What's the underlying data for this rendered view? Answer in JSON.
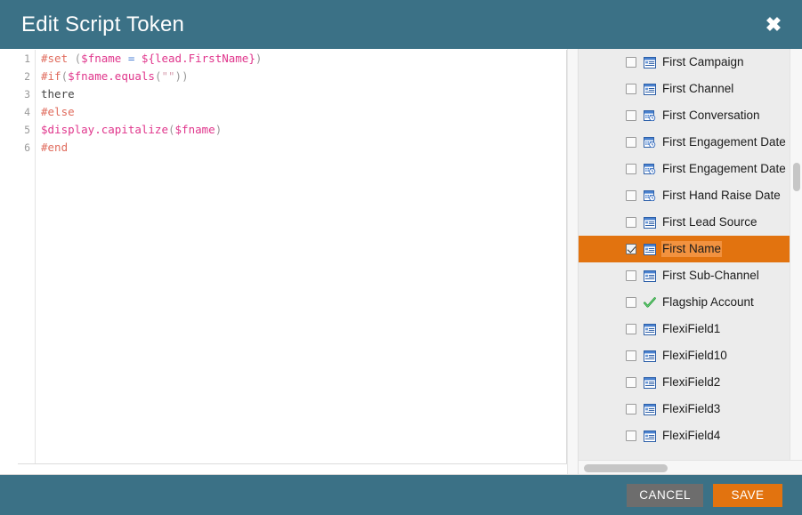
{
  "dialog": {
    "title": "Edit Script Token",
    "close_icon": "close-x-icon"
  },
  "editor": {
    "line_numbers": [
      "1",
      "2",
      "3",
      "4",
      "5",
      "6"
    ],
    "lines": [
      {
        "n": "1",
        "tokens": [
          {
            "t": "#set",
            "c": "directive"
          },
          {
            "t": " (",
            "c": "punct"
          },
          {
            "t": "$fname",
            "c": "var"
          },
          {
            "t": " ",
            "c": "plain"
          },
          {
            "t": "=",
            "c": "op"
          },
          {
            "t": " ",
            "c": "plain"
          },
          {
            "t": "${lead.FirstName}",
            "c": "var"
          },
          {
            "t": ")",
            "c": "punct"
          }
        ]
      },
      {
        "n": "2",
        "tokens": [
          {
            "t": "#if",
            "c": "directive"
          },
          {
            "t": "(",
            "c": "punct"
          },
          {
            "t": "$fname.equals",
            "c": "var"
          },
          {
            "t": "(",
            "c": "punct"
          },
          {
            "t": "\"\"",
            "c": "str"
          },
          {
            "t": "))",
            "c": "punct"
          }
        ]
      },
      {
        "n": "3",
        "tokens": [
          {
            "t": "there",
            "c": "plain"
          }
        ]
      },
      {
        "n": "4",
        "tokens": [
          {
            "t": "#else",
            "c": "directive"
          }
        ]
      },
      {
        "n": "5",
        "tokens": [
          {
            "t": "$display.capitalize",
            "c": "var"
          },
          {
            "t": "(",
            "c": "punct"
          },
          {
            "t": "$fname",
            "c": "var"
          },
          {
            "t": ")",
            "c": "punct"
          }
        ]
      },
      {
        "n": "6",
        "tokens": [
          {
            "t": "#end",
            "c": "directive"
          }
        ]
      }
    ]
  },
  "field_list": {
    "items": [
      {
        "label": "First Campaign",
        "icon": "text-field-icon",
        "checked": false,
        "selected": false
      },
      {
        "label": "First Channel",
        "icon": "text-field-icon",
        "checked": false,
        "selected": false
      },
      {
        "label": "First Conversation",
        "icon": "date-field-icon",
        "checked": false,
        "selected": false
      },
      {
        "label": "First Engagement Date",
        "icon": "date-field-icon",
        "checked": false,
        "selected": false
      },
      {
        "label": "First Engagement Date (",
        "icon": "date-field-icon",
        "checked": false,
        "selected": false
      },
      {
        "label": "First Hand Raise Date",
        "icon": "date-field-icon",
        "checked": false,
        "selected": false
      },
      {
        "label": "First Lead Source",
        "icon": "text-field-icon",
        "checked": false,
        "selected": false
      },
      {
        "label": "First Name",
        "icon": "text-field-icon",
        "checked": true,
        "selected": true
      },
      {
        "label": "First Sub-Channel",
        "icon": "text-field-icon",
        "checked": false,
        "selected": false
      },
      {
        "label": "Flagship Account",
        "icon": "boolean-field-icon",
        "checked": false,
        "selected": false
      },
      {
        "label": "FlexiField1",
        "icon": "text-field-icon",
        "checked": false,
        "selected": false
      },
      {
        "label": "FlexiField10",
        "icon": "text-field-icon",
        "checked": false,
        "selected": false
      },
      {
        "label": "FlexiField2",
        "icon": "text-field-icon",
        "checked": false,
        "selected": false
      },
      {
        "label": "FlexiField3",
        "icon": "text-field-icon",
        "checked": false,
        "selected": false
      },
      {
        "label": "FlexiField4",
        "icon": "text-field-icon",
        "checked": false,
        "selected": false
      }
    ]
  },
  "footer": {
    "cancel_label": "CANCEL",
    "save_label": "SAVE"
  },
  "colors": {
    "header_teal": "#3b7186",
    "accent_orange": "#e2730f",
    "cancel_gray": "#6d6d6d",
    "list_bg": "#ececec",
    "selected_label_bg": "#f2923f"
  }
}
